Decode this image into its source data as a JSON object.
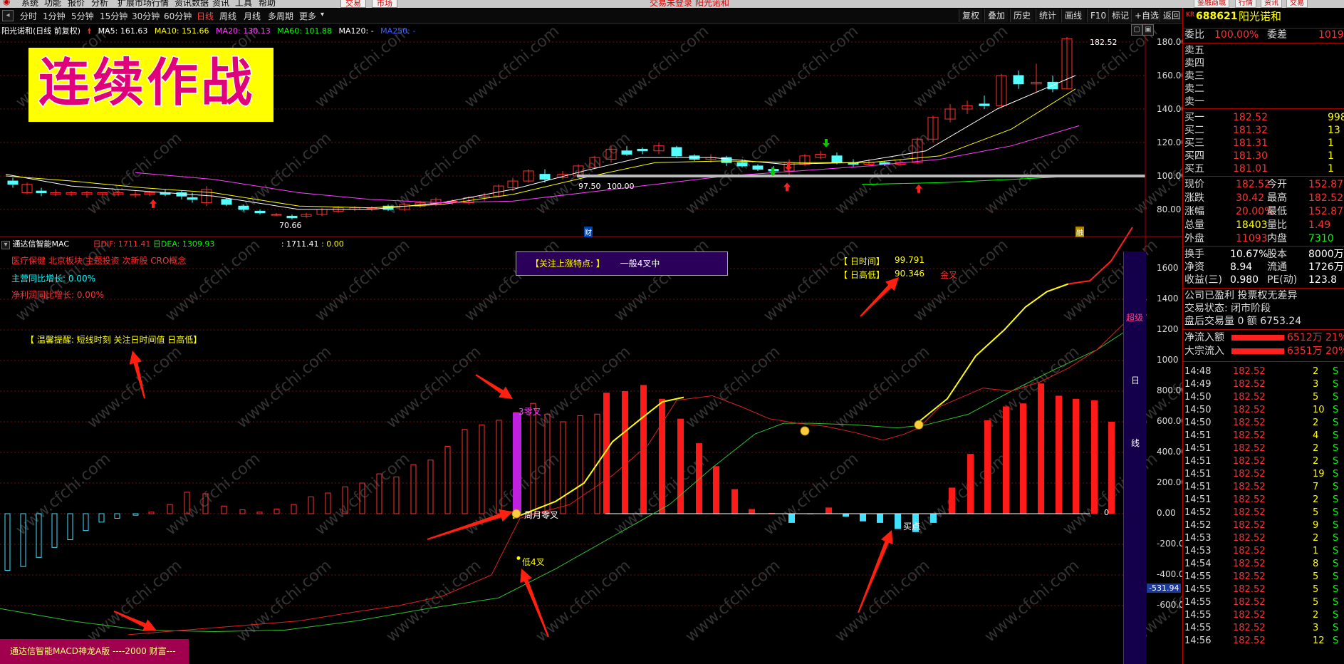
{
  "menubar": {
    "items": [
      "系统",
      "功能",
      "报价",
      "分析",
      "扩展市场行情",
      "资讯数据",
      "资讯",
      "工具",
      "帮助"
    ],
    "mode_buttons": [
      "交易",
      "市场"
    ],
    "center_text": "交易未登录 阳光诺和",
    "right_buttons": [
      "金融商城",
      "行情",
      "资讯",
      "交易"
    ]
  },
  "periods": [
    "分时",
    "1分钟",
    "5分钟",
    "15分钟",
    "30分钟",
    "60分钟",
    "日线",
    "周线",
    "月线",
    "多周期",
    "更多"
  ],
  "active_period": "日线",
  "toolbar": [
    "复权",
    "叠加",
    "历史",
    "统计",
    "画线",
    "F10",
    "标记",
    "+自选",
    "返回"
  ],
  "chart_header": {
    "title": "阳光诺和(日线 前复权)",
    "ma5": "MA5: 161.63",
    "ma10": "MA10: 151.66",
    "ma20": "MA20: 130.13",
    "ma60": "MA60: 101.88",
    "ma120": "MA120: -",
    "ma250": "MA250: -"
  },
  "banner": "连续作战",
  "price_axis": [
    "180.00",
    "160.00",
    "140.00",
    "120.00",
    "100.00",
    "80.00"
  ],
  "price_annotations": {
    "high": "182.52",
    "low": "70.66",
    "mid": "97.50",
    "mid2": "100.00",
    "cai": "财",
    "hui": "融"
  },
  "indicator": {
    "name": "通达信智能MAC",
    "dif": "日DIF: 1711.41",
    "dea": "日DEA: 1309.93",
    "v1": ": 1711.41",
    "v2": ": 0.00",
    "concepts": "医疗保健 北京板块 主题投资 次新股 CRO概念",
    "main_growth": "主营同比增长: 0.00%",
    "profit_growth": "净利润同比增长: 0.00%",
    "focus_title": "【关注上涨特点: 】",
    "focus_value": "一般4叉中",
    "day_time_label": "【 日时间】",
    "day_time": "99.791",
    "day_high_label": "【 日高低】",
    "day_high": "90.346",
    "golden": "金叉",
    "tip": "【 温馨提醒: 短线时刻 关注日时间值 日高低】",
    "cross3": "3零叉",
    "cross_week_month": "周月零叉",
    "cross_low4": "低4叉",
    "buy_point": "买点",
    "side_super": "超级",
    "side_day": "日",
    "side_line": "线",
    "neg_value": "-531.94",
    "zero_label": "0",
    "axis": [
      "1600",
      "1400",
      "1200",
      "1000",
      "800.00",
      "600.00",
      "400.00",
      "200.00",
      "0.00",
      "-200.00",
      "-400.00",
      "-600.00"
    ]
  },
  "bottom_label": "通达信智能MACD神龙A版 ----2000 财富---",
  "quote": {
    "code": "688621",
    "name": "阳光诺和",
    "kr": "KR",
    "weibi_label": "委比",
    "weibi": "100.00%",
    "weicha_label": "委差",
    "weicha": "1019",
    "asks": [
      [
        "卖五",
        ""
      ],
      [
        "卖四",
        ""
      ],
      [
        "卖三",
        ""
      ],
      [
        "卖二",
        ""
      ],
      [
        "卖一",
        ""
      ]
    ],
    "bids": [
      [
        "买一",
        "182.52",
        "998"
      ],
      [
        "买二",
        "181.32",
        "13"
      ],
      [
        "买三",
        "181.31",
        "1"
      ],
      [
        "买四",
        "181.30",
        "1"
      ],
      [
        "买五",
        "181.01",
        "1"
      ]
    ],
    "stats": [
      [
        "现价",
        "182.52",
        "今开",
        "152.87"
      ],
      [
        "涨跌",
        "30.42",
        "最高",
        "182.52"
      ],
      [
        "涨幅",
        "20.00%",
        "最低",
        "152.87"
      ],
      [
        "总量",
        "18403",
        "量比",
        "1.49"
      ],
      [
        "外盘",
        "11093",
        "内盘",
        "7310"
      ]
    ],
    "stats2": [
      [
        "换手",
        "10.67%",
        "股本",
        "8000万"
      ],
      [
        "净资",
        "8.94",
        "流通",
        "1726万"
      ],
      [
        "收益(三)",
        "0.980",
        "PE(动)",
        "123.8"
      ]
    ],
    "notes": [
      "公司已盈利 投票权无差异",
      "交易状态: 闭市阶段",
      "盘后交易量 0 额 6753.24"
    ],
    "flows": [
      [
        "净流入额",
        "6512万",
        "21%"
      ],
      [
        "大宗流入",
        "6351万",
        "20%"
      ]
    ],
    "ticks": [
      [
        "14:48",
        "182.52",
        "2",
        "S"
      ],
      [
        "14:49",
        "182.52",
        "3",
        "S"
      ],
      [
        "14:50",
        "182.52",
        "5",
        "S"
      ],
      [
        "14:50",
        "182.52",
        "10",
        "S"
      ],
      [
        "14:50",
        "182.52",
        "2",
        "S"
      ],
      [
        "14:51",
        "182.52",
        "4",
        "S"
      ],
      [
        "14:51",
        "182.52",
        "2",
        "S"
      ],
      [
        "14:51",
        "182.52",
        "2",
        "S"
      ],
      [
        "14:51",
        "182.52",
        "19",
        "S"
      ],
      [
        "14:51",
        "182.52",
        "7",
        "S"
      ],
      [
        "14:51",
        "182.52",
        "2",
        "S"
      ],
      [
        "14:52",
        "182.52",
        "5",
        "S"
      ],
      [
        "14:52",
        "182.52",
        "9",
        "S"
      ],
      [
        "14:53",
        "182.52",
        "2",
        "S"
      ],
      [
        "14:53",
        "182.52",
        "1",
        "S"
      ],
      [
        "14:54",
        "182.52",
        "8",
        "S"
      ],
      [
        "14:55",
        "182.52",
        "5",
        "S"
      ],
      [
        "14:55",
        "182.52",
        "5",
        "S"
      ],
      [
        "14:55",
        "182.52",
        "5",
        "S"
      ],
      [
        "14:55",
        "182.52",
        "2",
        "S"
      ],
      [
        "14:55",
        "182.52",
        "3",
        "S"
      ],
      [
        "14:56",
        "182.52",
        "12",
        "S"
      ]
    ]
  },
  "watermark": "www.cfchi.com"
}
